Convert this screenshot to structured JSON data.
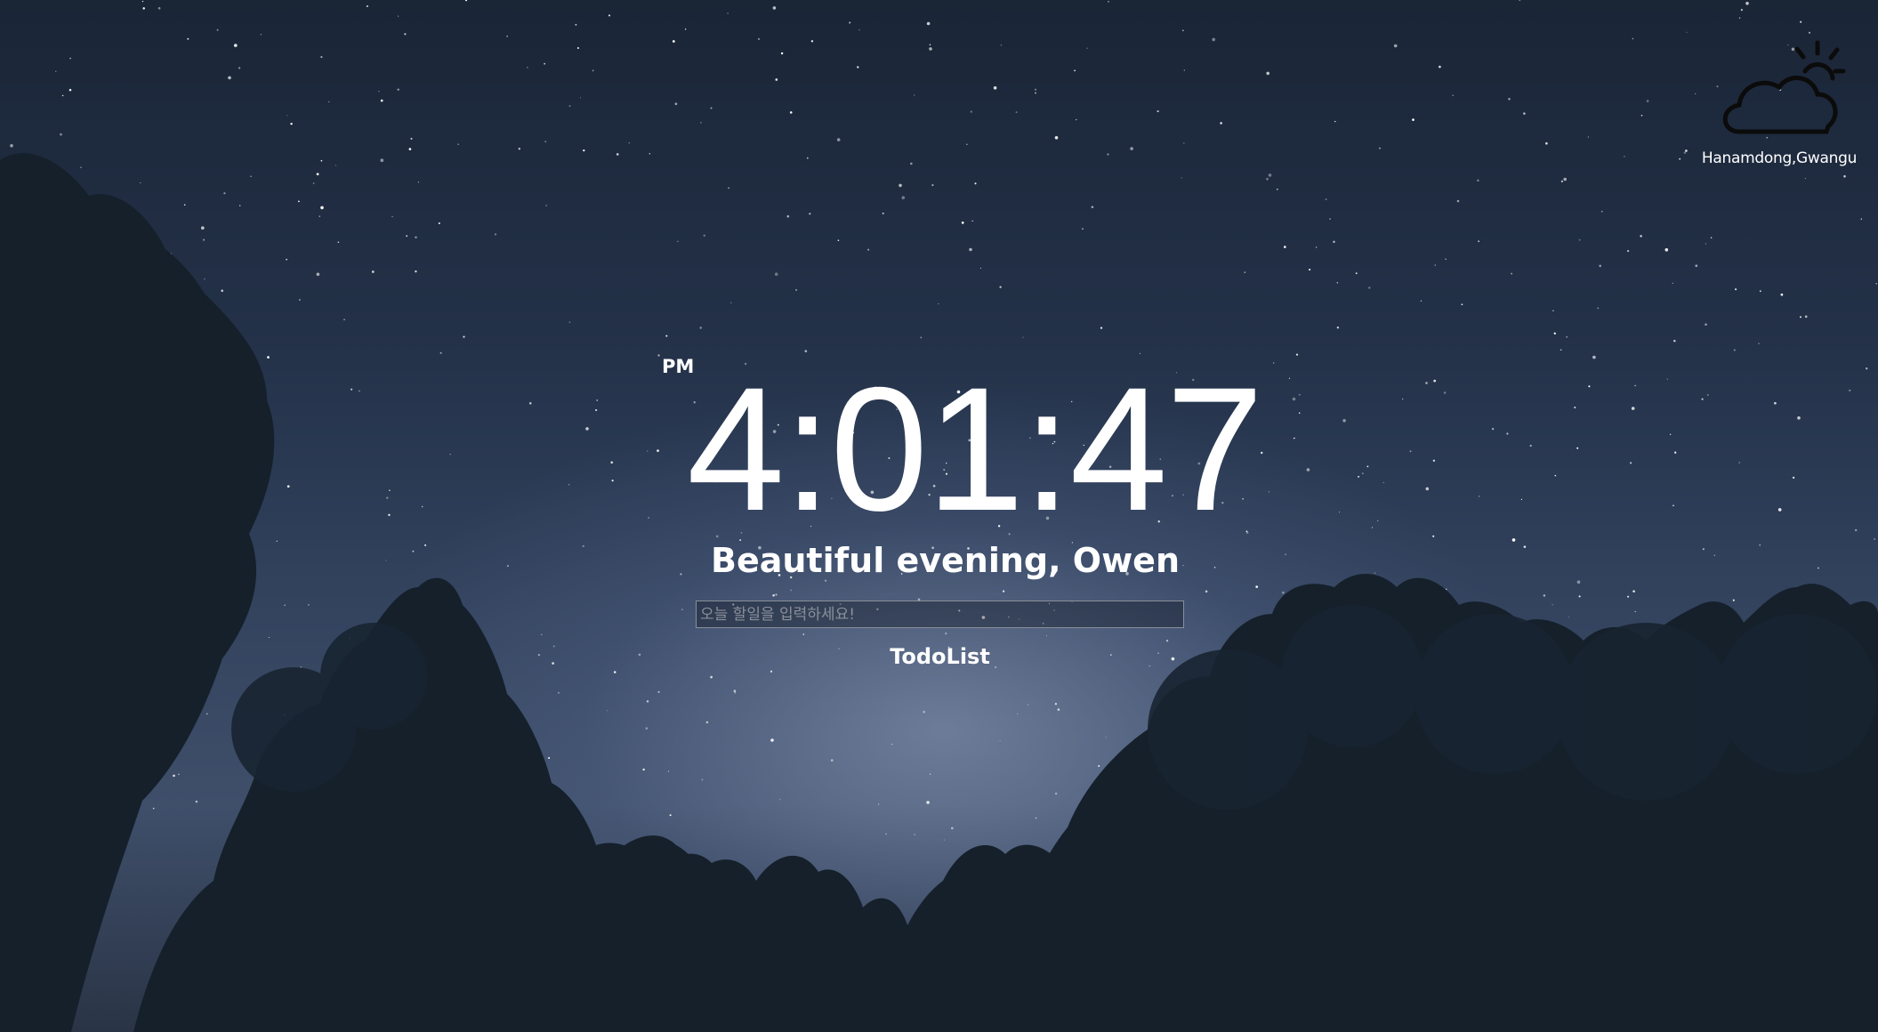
{
  "weather": {
    "icon": "partly-cloudy-icon",
    "location": "Hanamdong,Gwangu"
  },
  "clock": {
    "ampm": "PM",
    "time": "4:01:47"
  },
  "greeting": "Beautiful evening, Owen",
  "todo": {
    "placeholder": "오늘 할일을 입력하세요!",
    "value": "",
    "title": "TodoList",
    "items": []
  },
  "colors": {
    "text": "#ffffff",
    "sky_top": "#1a2536",
    "sky_glow": "#3f4f6a",
    "tree": "#15202b"
  }
}
